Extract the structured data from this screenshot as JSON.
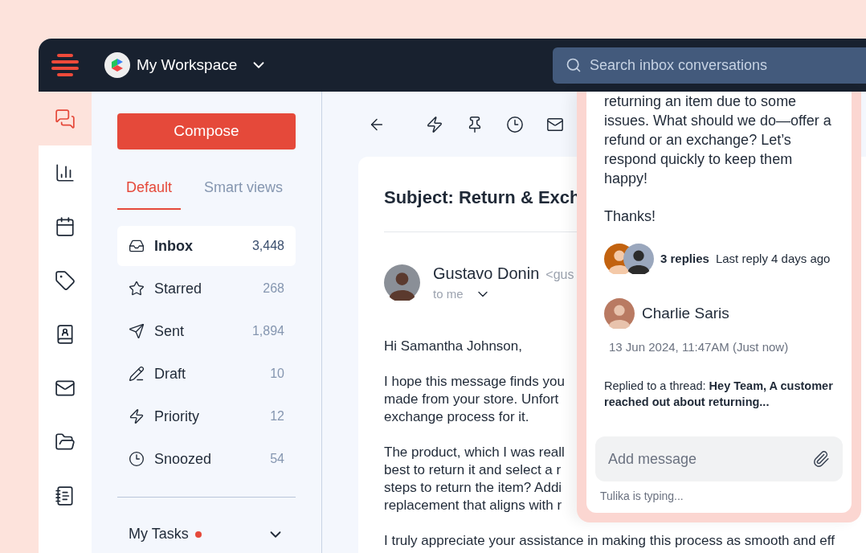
{
  "workspace": {
    "name": "My Workspace"
  },
  "search": {
    "placeholder": "Search inbox conversations"
  },
  "rail": [
    {
      "kind": "chat",
      "selected": true
    },
    {
      "kind": "chart",
      "selected": false
    },
    {
      "kind": "calendar",
      "selected": false
    },
    {
      "kind": "tag",
      "selected": false
    },
    {
      "kind": "contacts",
      "selected": false
    },
    {
      "kind": "mail",
      "selected": false
    },
    {
      "kind": "folder",
      "selected": false
    },
    {
      "kind": "note",
      "selected": false
    }
  ],
  "compose": "Compose",
  "view_tabs": [
    {
      "label": "Default",
      "selected": true
    },
    {
      "label": "Smart views",
      "selected": false
    }
  ],
  "folders": [
    {
      "kind": "inbox",
      "label": "Inbox",
      "count": "3,448",
      "selected": true
    },
    {
      "kind": "starred",
      "label": "Starred",
      "count": "268",
      "selected": false
    },
    {
      "kind": "sent",
      "label": "Sent",
      "count": "1,894",
      "selected": false
    },
    {
      "kind": "draft",
      "label": "Draft",
      "count": "10",
      "selected": false
    },
    {
      "kind": "priority",
      "label": "Priority",
      "count": "12",
      "selected": false
    },
    {
      "kind": "snoozed",
      "label": "Snoozed",
      "count": "54",
      "selected": false
    }
  ],
  "my_tasks": {
    "label": "My Tasks",
    "unread": true
  },
  "toolbar": [
    {
      "kind": "back"
    },
    {
      "kind": "priority"
    },
    {
      "kind": "pin"
    },
    {
      "kind": "snooze"
    },
    {
      "kind": "mail"
    }
  ],
  "email": {
    "subject": "Subject: Return & Exch",
    "sender": "Gustavo Donin",
    "sender_address": "<gus",
    "recipient": "to me",
    "body": [
      [
        "Hi Samantha Johnson,"
      ],
      [
        "I hope this message finds you",
        "made from your store. Unfort",
        "exchange process for it."
      ],
      [
        "The product, which I was reall",
        "best to return it and select a r",
        "steps to return the item? Addi",
        "replacement that aligns with r"
      ],
      [
        "I truly appreciate your assistance in making this process as smooth and eff"
      ]
    ]
  },
  "thread": {
    "message": "returning an item due to some issues. What should we do—offer a refund or an exchange? Let’s respond quickly to keep them happy!",
    "sign_off": "Thanks!",
    "replies": "3 replies",
    "last_reply": "Last reply 4 days ago",
    "comment": {
      "author": "Charlie Saris",
      "time": "13 Jun 2024, 11:47AM (Just now)",
      "text": "Replied to a thread: **Hey Team, A customer reached out about returning...**"
    },
    "input": {
      "placeholder": "Add message"
    },
    "typing": "Tulika is typing..."
  }
}
